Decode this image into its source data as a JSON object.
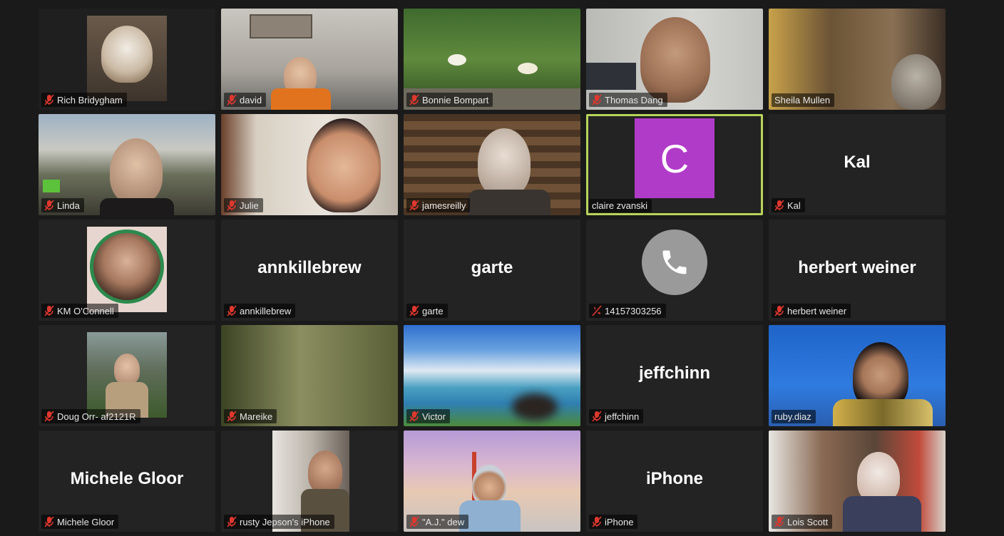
{
  "participants": [
    {
      "name": "Rich Bridygham",
      "type": "video"
    },
    {
      "name": "david",
      "type": "video"
    },
    {
      "name": "Bonnie Bompart",
      "type": "video"
    },
    {
      "name": "Thomas Dang",
      "type": "video"
    },
    {
      "name": "Sheila Mullen",
      "type": "video"
    },
    {
      "name": "Linda",
      "type": "video"
    },
    {
      "name": "Julie",
      "type": "video"
    },
    {
      "name": "jamesreilly",
      "type": "video"
    },
    {
      "name": "claire zvanski",
      "type": "avatar",
      "initial": "C",
      "active": true
    },
    {
      "name": "Kal",
      "type": "name",
      "display": "Kal"
    },
    {
      "name": "KM O'Connell",
      "type": "video"
    },
    {
      "name": "annkillebrew",
      "type": "name",
      "display": "annkillebrew"
    },
    {
      "name": "garte",
      "type": "name",
      "display": "garte"
    },
    {
      "name": "14157303256",
      "type": "phone"
    },
    {
      "name": "herbert weiner",
      "type": "name",
      "display": "herbert weiner"
    },
    {
      "name": "Doug Orr- af2121R",
      "type": "video"
    },
    {
      "name": "Mareike",
      "type": "video"
    },
    {
      "name": "Victor",
      "type": "video"
    },
    {
      "name": "jeffchinn",
      "type": "name",
      "display": "jeffchinn"
    },
    {
      "name": "ruby.diaz",
      "type": "video"
    },
    {
      "name": "Michele Gloor",
      "type": "name",
      "display": "Michele Gloor"
    },
    {
      "name": "rusty Jepson's iPhone",
      "type": "video"
    },
    {
      "name": "\"A.J.\" dew",
      "type": "video"
    },
    {
      "name": "iPhone",
      "type": "name",
      "display": "iPhone"
    },
    {
      "name": "Lois Scott",
      "type": "video"
    }
  ],
  "colors": {
    "background": "#1a1a1a",
    "tile": "#232323",
    "active_speaker_border": "#b8d35a",
    "muted_mic": "#e0372e",
    "avatar_purple": "#b13bc9"
  }
}
